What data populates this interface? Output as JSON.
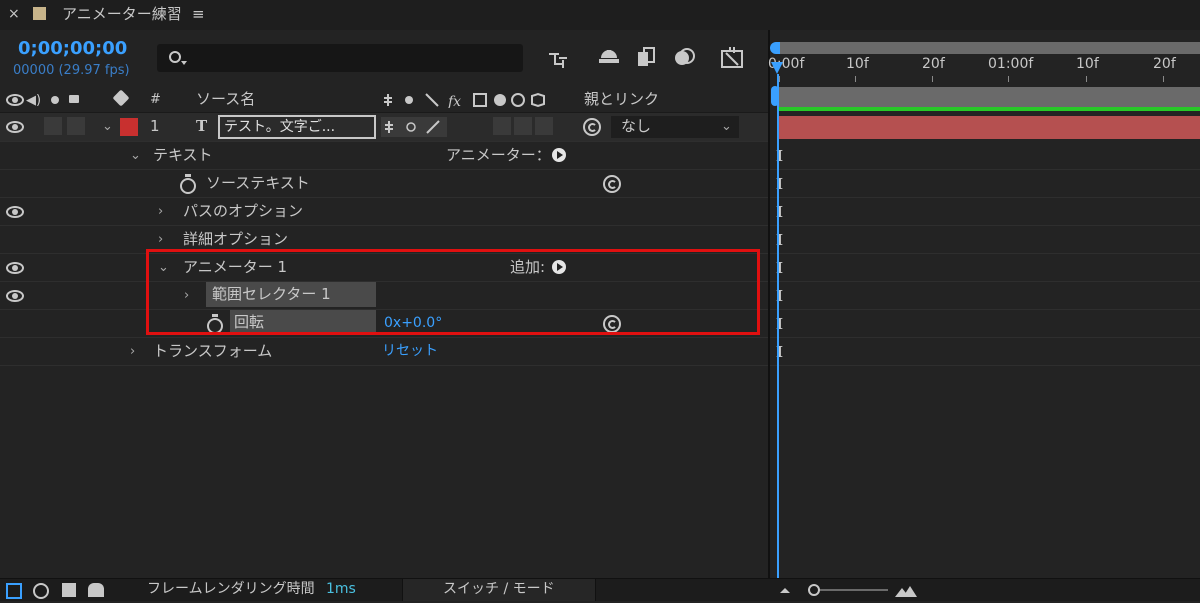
{
  "window": {
    "close_glyph": "×",
    "title": "アニメーター練習",
    "menu_glyph": "≡"
  },
  "timecode": {
    "value": "0;00;00;00",
    "frames": "00000 (29.97 fps)"
  },
  "search": {
    "placeholder": ""
  },
  "columns": {
    "number": "#",
    "source_name": "ソース名",
    "parent": "親とリンク"
  },
  "layer": {
    "number": "1",
    "type_glyph": "T",
    "name": "テスト。文字ご...",
    "parent_value": "なし"
  },
  "properties": {
    "text": "テキスト",
    "animate_label": "アニメーター：",
    "source_text": "ソーステキスト",
    "path_options": "パスのオプション",
    "more_options": "詳細オプション",
    "animator": "アニメーター 1",
    "add_label": "追加:",
    "range_selector": "範囲セレクター 1",
    "rotation": "回転",
    "rotation_value": "0x+0.0°",
    "transform": "トランスフォーム",
    "reset": "リセット"
  },
  "ruler": {
    "labels": [
      "0:00f",
      "10f",
      "20f",
      "01:00f",
      "10f",
      "20f"
    ]
  },
  "bottom_bar": {
    "render_label": "フレームレンダリング時間",
    "render_time": "1ms",
    "toggle_label": "スイッチ / モード"
  },
  "colors": {
    "accent_blue": "#3aa0ff",
    "label_red": "#c8302f",
    "highlight_red": "#e01010",
    "layer_bar": "#b55050",
    "work_area_green": "#28c828"
  }
}
